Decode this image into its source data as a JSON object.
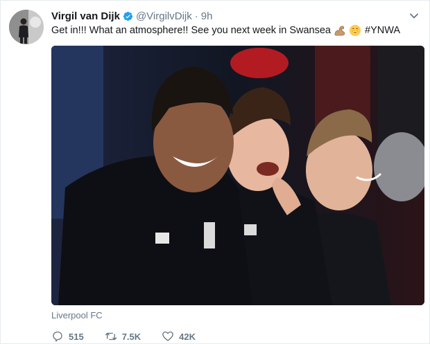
{
  "tweet": {
    "display_name": "Virgil van Dijk",
    "handle": "@VirgilvDijk",
    "separator": "·",
    "time": "9h",
    "text": "Get in!!! What an atmosphere!! See you next week in Swansea",
    "hashtag": "#YNWA",
    "emojis": [
      "flexed-biceps-icon",
      "grinning-face-icon"
    ],
    "photo_caption": "Liverpool FC"
  },
  "actions": {
    "reply_count": "515",
    "retweet_count": "7.5K",
    "like_count": "42K"
  },
  "colors": {
    "verified": "#1da1f2",
    "secondary_text": "#657786",
    "border": "#e6ecf0"
  }
}
